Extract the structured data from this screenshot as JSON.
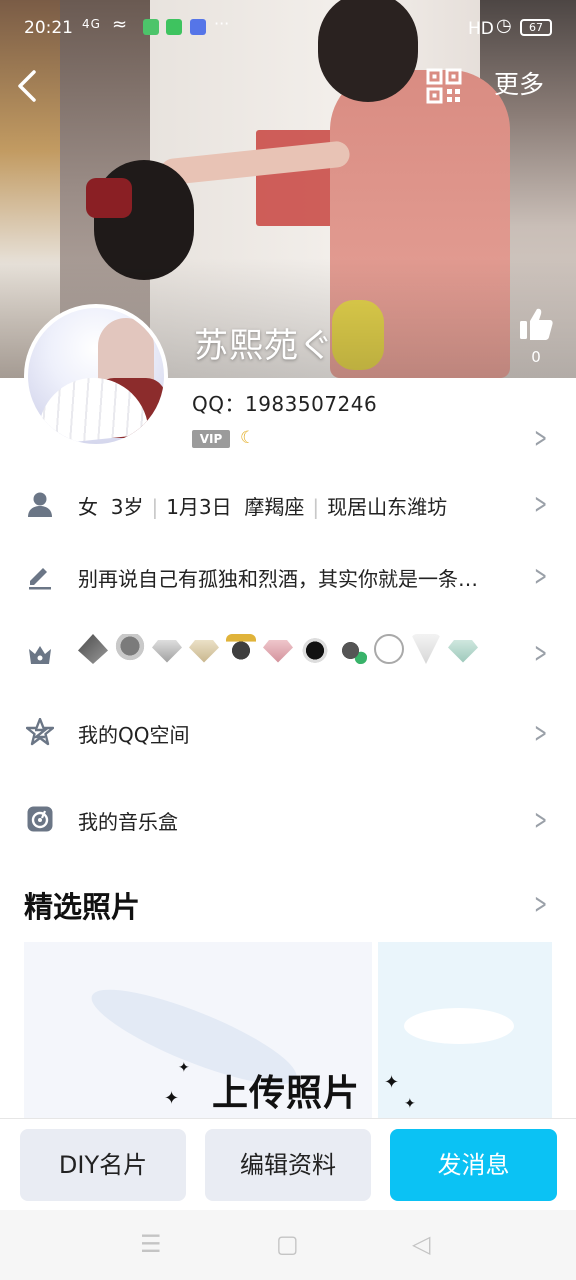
{
  "status_bar": {
    "time": "20:21",
    "signal": "4G",
    "hd": "HD",
    "battery": "67",
    "more_dots": "···"
  },
  "nav": {
    "more_label": "更多"
  },
  "profile": {
    "nickname": "苏熙苑ぐ",
    "like_count": "0",
    "qq_number": "QQ：1983507246",
    "vip_label": "VIP"
  },
  "info_row": {
    "gender": "女",
    "age": "3岁",
    "birthday": "1月3日",
    "zodiac": "摩羯座",
    "location": "现居山东潍坊"
  },
  "signature": "别再说自己有孤独和烈酒，其实你就是一条…",
  "badges": [
    "badge-1",
    "badge-2",
    "badge-3",
    "badge-4",
    "badge-5",
    "badge-6",
    "badge-7",
    "badge-8",
    "badge-9",
    "badge-10",
    "badge-11"
  ],
  "links": {
    "qzone": "我的QQ空间",
    "music_box": "我的音乐盒"
  },
  "photos": {
    "section_title": "精选照片",
    "upload_label": "上传照片"
  },
  "actions": {
    "diy_card": "DIY名片",
    "edit_profile": "编辑资料",
    "send_message": "发消息"
  },
  "colors": {
    "primary": "#0bc2f4",
    "secondary_button": "#e9ecf3",
    "icon_grey": "#6b7686"
  }
}
